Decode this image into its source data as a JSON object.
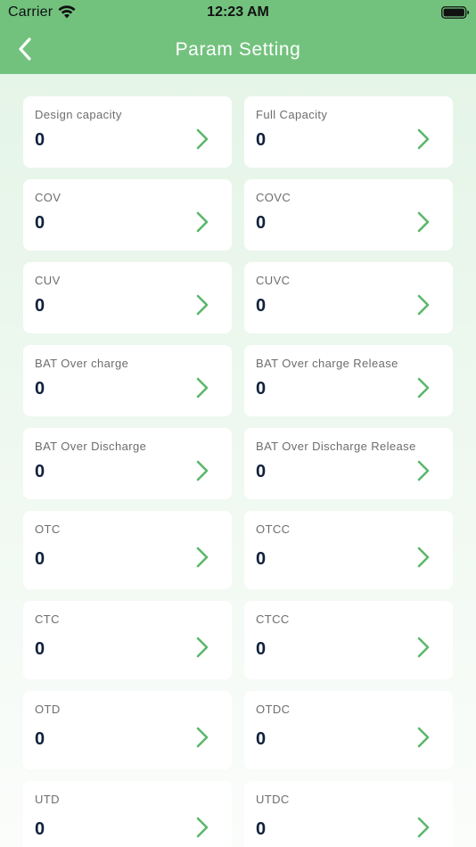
{
  "status_bar": {
    "carrier": "Carrier",
    "time": "12:23 AM"
  },
  "nav": {
    "title": "Param Setting",
    "back_icon": "chevron-left-icon"
  },
  "colors": {
    "header": "#72c27e",
    "accent": "#5bb86a",
    "value": "#10203d",
    "label": "#6d6d6d"
  },
  "cards": [
    {
      "label": "Design capacity",
      "value": "0"
    },
    {
      "label": "Full Capacity",
      "value": "0"
    },
    {
      "label": "COV",
      "value": "0"
    },
    {
      "label": "COVC",
      "value": "0"
    },
    {
      "label": "CUV",
      "value": "0"
    },
    {
      "label": "CUVC",
      "value": "0"
    },
    {
      "label": "BAT Over charge",
      "value": "0"
    },
    {
      "label": "BAT Over charge Release",
      "value": "0"
    },
    {
      "label": "BAT Over Discharge",
      "value": "0"
    },
    {
      "label": "BAT Over Discharge Release",
      "value": "0"
    },
    {
      "label": "OTC",
      "value": "0"
    },
    {
      "label": "OTCC",
      "value": "0"
    },
    {
      "label": "CTC",
      "value": "0"
    },
    {
      "label": "CTCC",
      "value": "0"
    },
    {
      "label": "OTD",
      "value": "0"
    },
    {
      "label": "OTDC",
      "value": "0"
    },
    {
      "label": "UTD",
      "value": "0"
    },
    {
      "label": "UTDC",
      "value": "0"
    }
  ]
}
